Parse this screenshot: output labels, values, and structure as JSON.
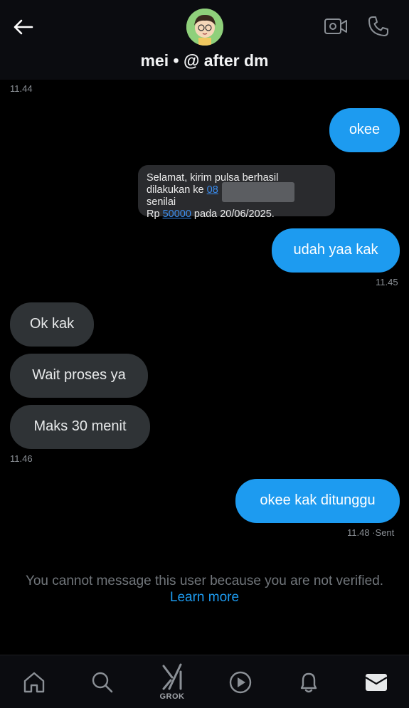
{
  "header": {
    "title": "mei • @ after dm",
    "back_icon": "arrow-left-icon",
    "video_icon": "video-camera-icon",
    "call_icon": "phone-icon"
  },
  "messages": {
    "ts_top": "11.44",
    "m1": "okee",
    "sms": {
      "line1": "Selamat, kirim pulsa berhasil",
      "line2_prefix": "dilakukan ke ",
      "line2_number": "08",
      "line2_suffix": "senilai",
      "line3_prefix": "Rp ",
      "line3_amount": "50000",
      "line3_suffix": " pada 20/06/2025."
    },
    "m2": "udah yaa kak",
    "ts_m2": "11.45",
    "r1": "Ok kak",
    "r2": "Wait proses ya",
    "r3": "Maks 30 menit",
    "ts_r3": "11.46",
    "m3": "okee kak ditunggu",
    "ts_m3": "11.48",
    "ts_m3_status": " ·Sent"
  },
  "notice": {
    "text": "You cannot message this user because you are not verified.",
    "link": "Learn more"
  },
  "nav": {
    "grok_label": "GROK",
    "items": [
      "home-icon",
      "search-icon",
      "grok-icon",
      "play-icon",
      "bell-icon",
      "mail-icon"
    ]
  },
  "colors": {
    "accent": "#1d9bf0",
    "incoming_bubble": "#2f3336",
    "background": "#000000"
  }
}
